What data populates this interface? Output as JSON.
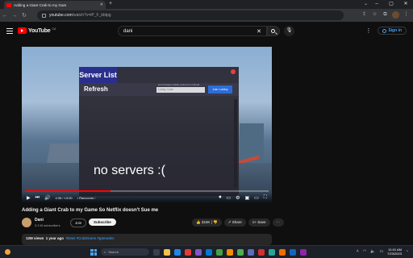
{
  "browser": {
    "tab_title": "Adding a Giant Crab to my Gam",
    "url_domain": "youtube.com",
    "url_path": "/watch?v=iP_F_kbtpg"
  },
  "youtube": {
    "logo_text": "YouTube",
    "region": "CA",
    "search_query": "dani",
    "signin_label": "Sign in"
  },
  "game": {
    "server_list_title": "Server List",
    "refresh_label": "Refresh",
    "lobby_hint": "join through a lobby code from a friend",
    "lobby_code_placeholder": "Lobby Code",
    "join_lobby_label": "Join Lobby",
    "empty_message": "no servers :("
  },
  "player": {
    "time": "4:36 / 13:00",
    "chapter": "• Raccoons ›",
    "progress_fraction": 0.35
  },
  "video": {
    "title": "Adding a Giant Crab to my Game So Netflix doesn't Sue me",
    "channel": "Dani",
    "subscribers": "3.3 M subscribers",
    "join_label": "Join",
    "subscribe_label": "Subscribe",
    "likes": "324K",
    "share_label": "Share",
    "save_label": "Save",
    "views": "12M views",
    "age": "1 year ago",
    "tags": "#Dani #CrabGame #gamedev"
  },
  "taskbar": {
    "search_label": "Search",
    "time": "11:01 AM",
    "date": "7/23/2023"
  }
}
